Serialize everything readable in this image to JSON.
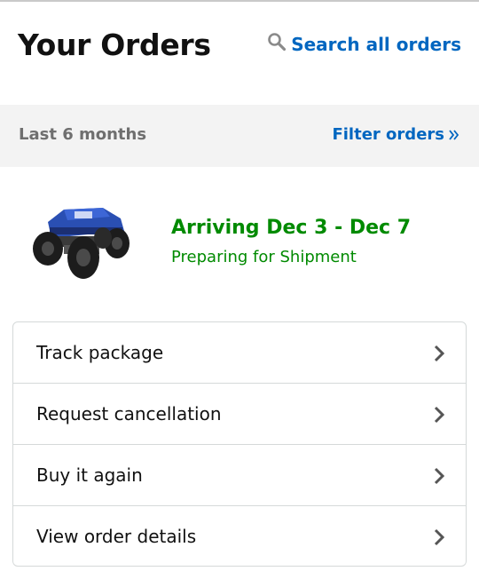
{
  "header": {
    "title": "Your Orders",
    "search_label": "Search all orders"
  },
  "filter_bar": {
    "period": "Last 6 months",
    "filter_label": "Filter orders"
  },
  "order": {
    "product_image": "rc-rock-crawler-truck",
    "arrival": "Arriving Dec 3 - Dec 7",
    "status": "Preparing for Shipment"
  },
  "actions": [
    {
      "label": "Track package"
    },
    {
      "label": "Request cancellation"
    },
    {
      "label": "Buy it again"
    },
    {
      "label": "View order details"
    }
  ],
  "colors": {
    "link": "#0066c0",
    "status_green": "#008a00",
    "title": "#111111",
    "filter_bg": "#f3f3f3"
  }
}
